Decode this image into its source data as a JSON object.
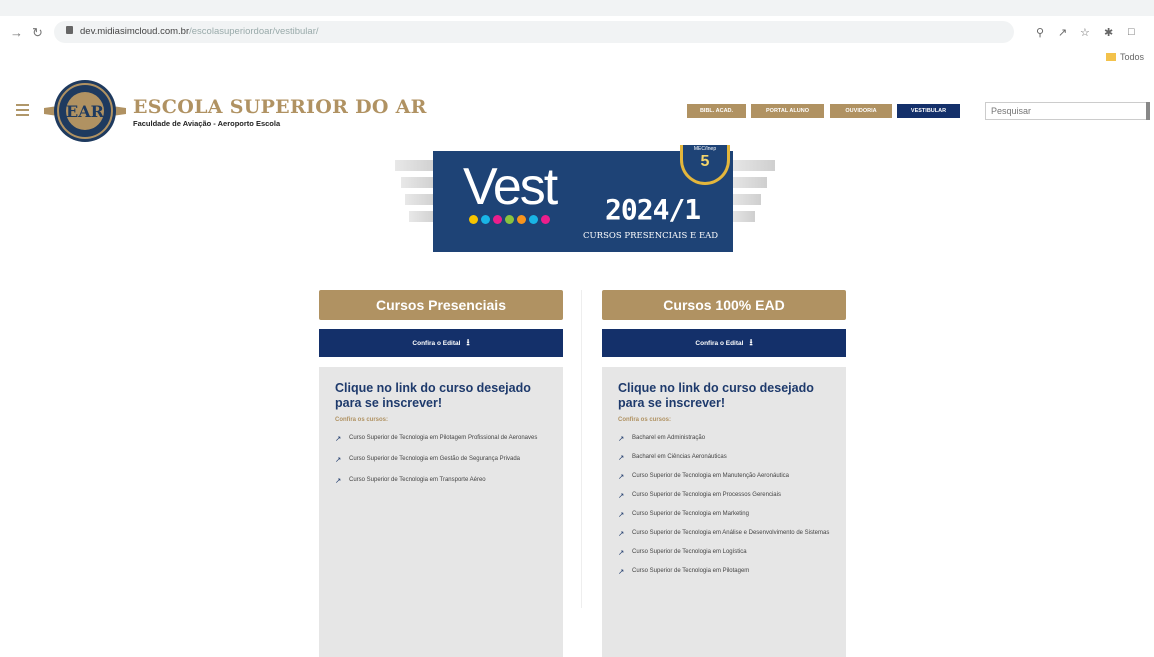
{
  "browser": {
    "url_host": "dev.midiasimcloud.com.br",
    "url_path": "/escolasuperiordoar/vestibular/",
    "bookmark_label": "Todos"
  },
  "header": {
    "brand_name": "ESCOLA SUPERIOR DO AR",
    "brand_sub": "Faculdade de Aviação - Aeroporto Escola",
    "logo_text": "EAR",
    "nav": [
      {
        "label": "BIBL. ACAD.",
        "style": "gold"
      },
      {
        "label": "PORTAL ALUNO",
        "style": "gold"
      },
      {
        "label": "OUVIDORIA",
        "style": "gold"
      },
      {
        "label": "VESTIBULAR",
        "style": "navy"
      }
    ],
    "search_placeholder": "Pesquisar"
  },
  "banner": {
    "vest": "Vest",
    "year": "2024/1",
    "subtitle": "CURSOS PRESENCIAIS E EAD",
    "seal_top": "MEC/Inep",
    "seal_score": "5",
    "dot_colors": [
      "#f5c400",
      "#19b5e6",
      "#ec1e8c",
      "#8ac43f",
      "#f7941d",
      "#19b5e6",
      "#ec1e8c"
    ]
  },
  "columns": [
    {
      "title": "Cursos Presenciais",
      "edital_label": "Confira o Edital",
      "heading": "Clique no link do curso desejado para se inscrever!",
      "confira": "Confira os cursos:",
      "courses": [
        "Curso Superior de Tecnologia em Pilotagem Profissional de Aeronaves",
        "Curso Superior de Tecnologia em Gestão de Segurança Privada",
        "Curso Superior de Tecnologia em Transporte Aéreo"
      ]
    },
    {
      "title": "Cursos 100% EAD",
      "edital_label": "Confira o Edital",
      "heading": "Clique no link do curso desejado para se inscrever!",
      "confira": "Confira os cursos:",
      "courses": [
        "Bacharel em Administração",
        "Bacharel em Ciências Aeronáuticas",
        "Curso Superior de Tecnologia em Manutenção Aeronáutica",
        "Curso Superior de Tecnologia em Processos Gerenciais",
        "Curso Superior de Tecnologia em Marketing",
        "Curso Superior de Tecnologia em Análise e Desenvolvimento de Sistemas",
        "Curso Superior de Tecnologia em Logística",
        "Curso Superior de Tecnologia em Pilotagem"
      ]
    }
  ],
  "colors": {
    "gold": "#b09262",
    "navy": "#14306a",
    "banner_blue": "#1e4376"
  }
}
